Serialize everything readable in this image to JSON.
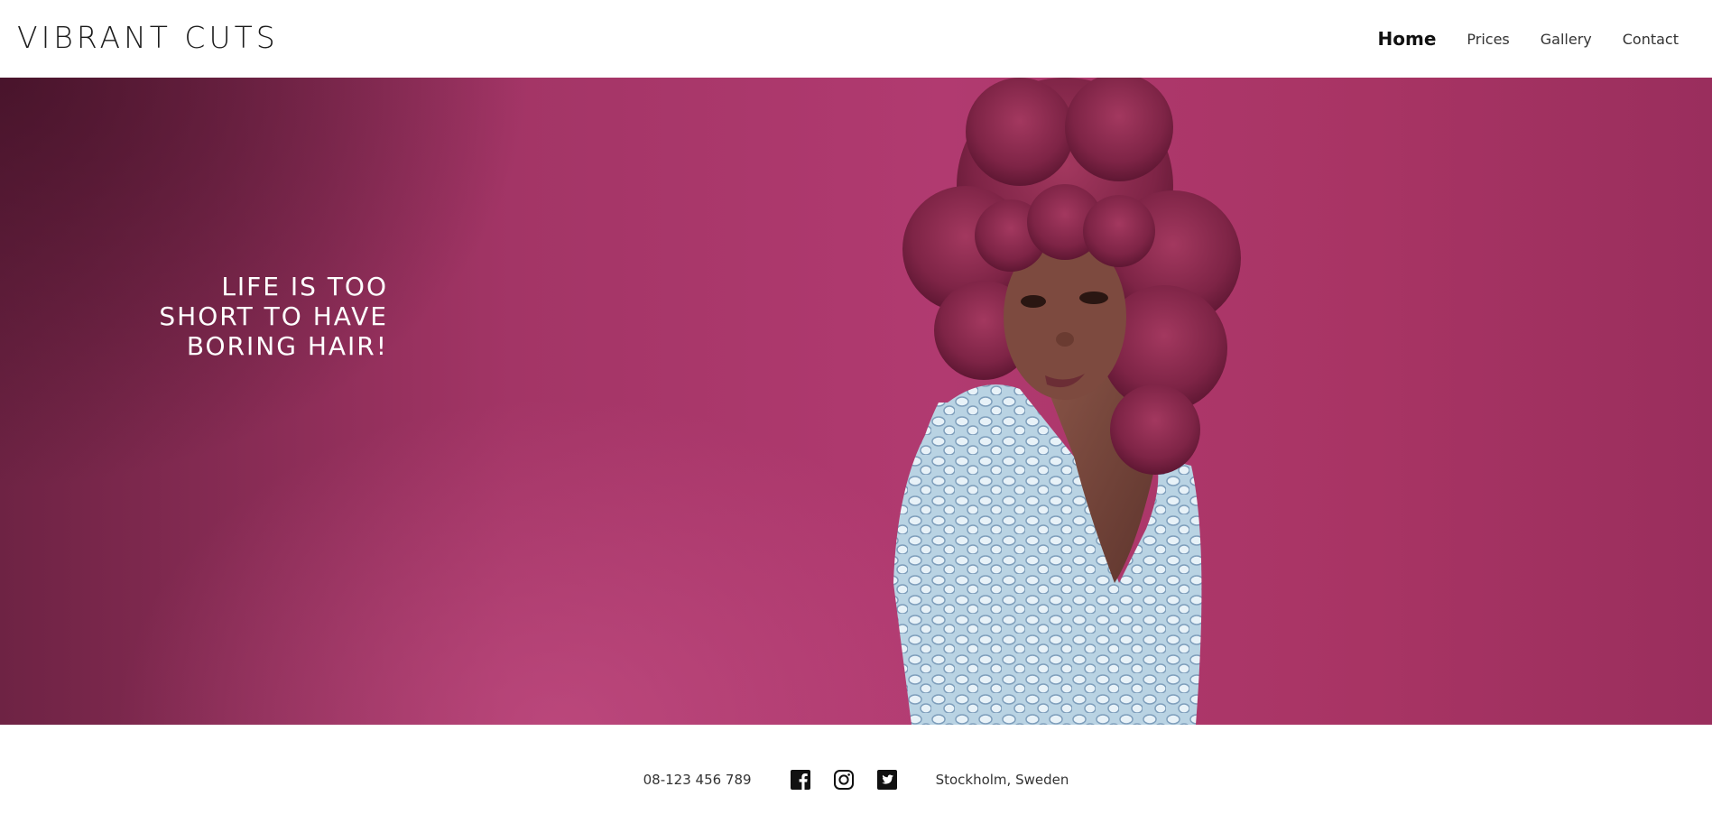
{
  "header": {
    "logo": "VIBRANT CUTS",
    "nav": [
      {
        "label": "Home",
        "active": true
      },
      {
        "label": "Prices",
        "active": false
      },
      {
        "label": "Gallery",
        "active": false
      },
      {
        "label": "Contact",
        "active": false
      }
    ]
  },
  "hero": {
    "headline_lines": [
      "LIFE IS TOO",
      "SHORT TO HAVE",
      "BORING HAIR!"
    ]
  },
  "footer": {
    "phone": "08-123 456 789",
    "location": "Stockholm, Sweden",
    "social": [
      "facebook-icon",
      "instagram-icon",
      "twitter-icon"
    ]
  },
  "colors": {
    "hero_background": "#a83464",
    "text_dark": "#1b1b1b",
    "text_light": "#ffffff"
  }
}
